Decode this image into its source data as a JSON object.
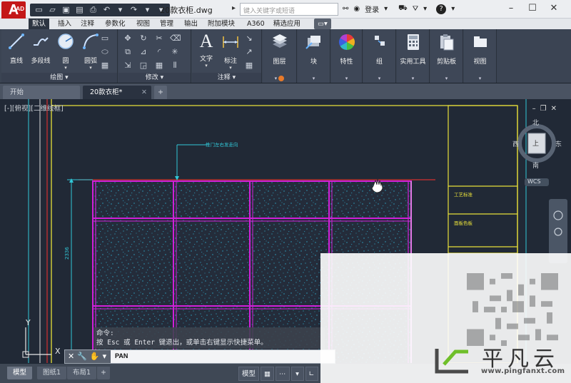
{
  "titlebar": {
    "app_letter": "A",
    "app_sub": "CAD",
    "document_title": "20款衣柜.dwg",
    "search_placeholder": "键入关键字或短语",
    "login_label": "登录",
    "help_label": "?"
  },
  "ribbon_tabs": [
    "默认",
    "插入",
    "注释",
    "参数化",
    "视图",
    "管理",
    "输出",
    "附加模块",
    "A360",
    "精选应用"
  ],
  "ribbon": {
    "draw_group": {
      "title": "绘图",
      "tools": [
        "直线",
        "多段线",
        "圆",
        "圆弧"
      ]
    },
    "modify_group": {
      "title": "修改"
    },
    "annotation_group": {
      "title": "注释",
      "tools": [
        "文字",
        "标注"
      ]
    },
    "panels": [
      "图层",
      "块",
      "特性",
      "组",
      "实用工具",
      "剪贴板",
      "视图"
    ]
  },
  "file_tabs": [
    "开始",
    "20款衣柜*"
  ],
  "drawing": {
    "viewport_label": "[-][俯视][二维线框]",
    "leader_text": "推门左右发走向",
    "dimension_text": "2336",
    "side_labels": [
      "工艺标准",
      "面板色板"
    ],
    "viewcube": {
      "north": "北",
      "south": "南",
      "east": "东",
      "west": "西",
      "wcs": "WCS",
      "face": "上"
    },
    "ucs": {
      "x": "X",
      "y": "Y"
    }
  },
  "command_history": [
    "命令:",
    "按 Esc 或 Enter 键退出，或单击右键显示快捷菜单。"
  ],
  "command_line": {
    "text": "PAN"
  },
  "layout_tabs": [
    "模型",
    "图纸1",
    "布局1"
  ],
  "status_bar": {
    "model_label": "模型"
  },
  "watermark": {
    "brand": "平凡云",
    "url": "www.pingfanxt.com"
  },
  "colors": {
    "cad_background": "#212936",
    "ribbon_bg": "#3b4453",
    "magenta": "#d020d8",
    "yellow": "#e8e03a",
    "cyan": "#31c8d8",
    "app_red": "#c41818"
  }
}
